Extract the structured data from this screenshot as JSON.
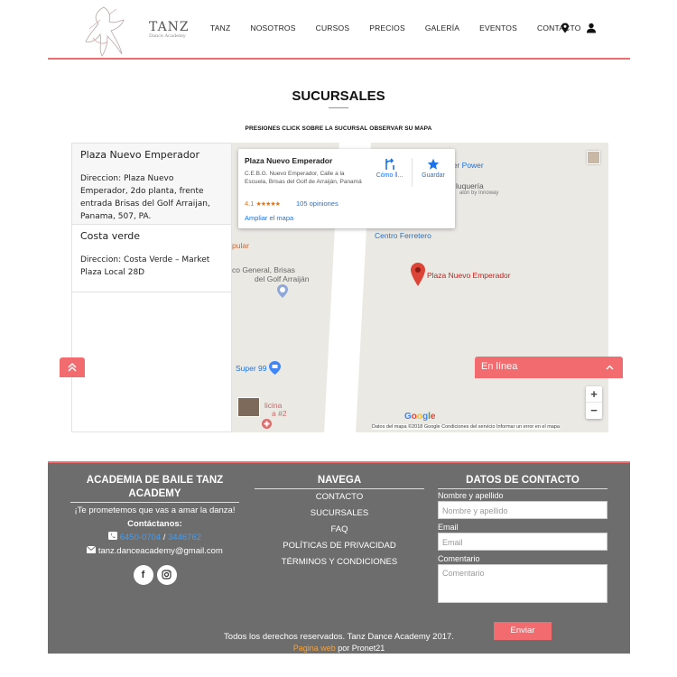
{
  "brand": {
    "name": "TANZ",
    "tagline": "Dance Academy"
  },
  "nav": {
    "items": [
      "TANZ",
      "NOSOTROS",
      "CURSOS",
      "PRECIOS",
      "GALERÍA",
      "EVENTOS",
      "CONTACTO"
    ],
    "icons": [
      "location-pin-icon",
      "user-icon"
    ]
  },
  "page": {
    "title": "SUCURSALES",
    "instruction": "PRESIONES CLICK SOBRE LA SUCURSAL OBSERVAR SU MAPA"
  },
  "branches": [
    {
      "name": "Plaza Nuevo Emperador",
      "address": "Direccion: Plaza Nuevo Emperador, 2do planta, frente entrada Brisas del Golf Arraijan, Panama, 507, PA."
    },
    {
      "name": "Costa verde",
      "address": "Direccion: Costa Verde – Market Plaza Local 28D"
    }
  ],
  "map": {
    "card": {
      "title": "Plaza Nuevo Emperador",
      "address": "C.E.B.G. Nuevo Emperador, Calle a la Escuela, Brisas del Golf de Arraiján, Panamá",
      "rating": "4.1",
      "rating_value": 4.1,
      "stars": "★★★★★",
      "reviews": "105 opiniones",
      "expand": "Ampliar el mapa",
      "directions": "Cómo ll...",
      "save": "Guardar"
    },
    "labels": {
      "super_power": "per Power",
      "peluqueria": "luquería",
      "salon": "alon by Innoway",
      "centro": "Centro Ferretero",
      "popular": "pular",
      "hospital": "co General, Brisas",
      "hospital2": "del Golf Arraiján",
      "super99": "Super 99",
      "clinica": "licina",
      "clinica2": "a #2",
      "pin": "Plaza Nuevo Emperador"
    },
    "google": "Google",
    "footer": "Datos del mapa ©2018 Google    Condiciones del servicio    Informar un error en el mapa"
  },
  "chat": {
    "label": "En línea"
  },
  "footer": {
    "academy_title": "ACADEMIA DE BAILE TANZ ACADEMY",
    "promise": "¡Te prometemos que vas a amar la danza!",
    "contact_label": "Contáctanos:",
    "phone1": "6450-0704",
    "phone_sep": " / ",
    "phone2": "3446762",
    "email": "tanz.danceacademy@gmail.com",
    "nav_title": "NAVEGA",
    "nav_links": [
      "CONTACTO",
      "SUCURSALES",
      "FAQ",
      "POLÍTICAS DE PRIVACIDAD",
      "TÉRMINOS Y CONDICIONES"
    ],
    "contact_title": "DATOS DE CONTACTO",
    "form": {
      "name_label": "Nombre y apellido",
      "name_placeholder": "Nombre y apellido",
      "email_label": "Email",
      "email_placeholder": "Email",
      "comment_label": "Comentario",
      "comment_placeholder": "Comentario",
      "send": "Enviar"
    },
    "copyright": "Todos los derechos reservados. Tanz Dance Academy 2017.",
    "credit_link": "Pagina web",
    "credit_rest": " por Pronet21"
  },
  "colors": {
    "accent": "#f16b6f",
    "footer_bg": "#6d6d6d",
    "link": "#1a73e8",
    "pin": "#c5221f"
  }
}
